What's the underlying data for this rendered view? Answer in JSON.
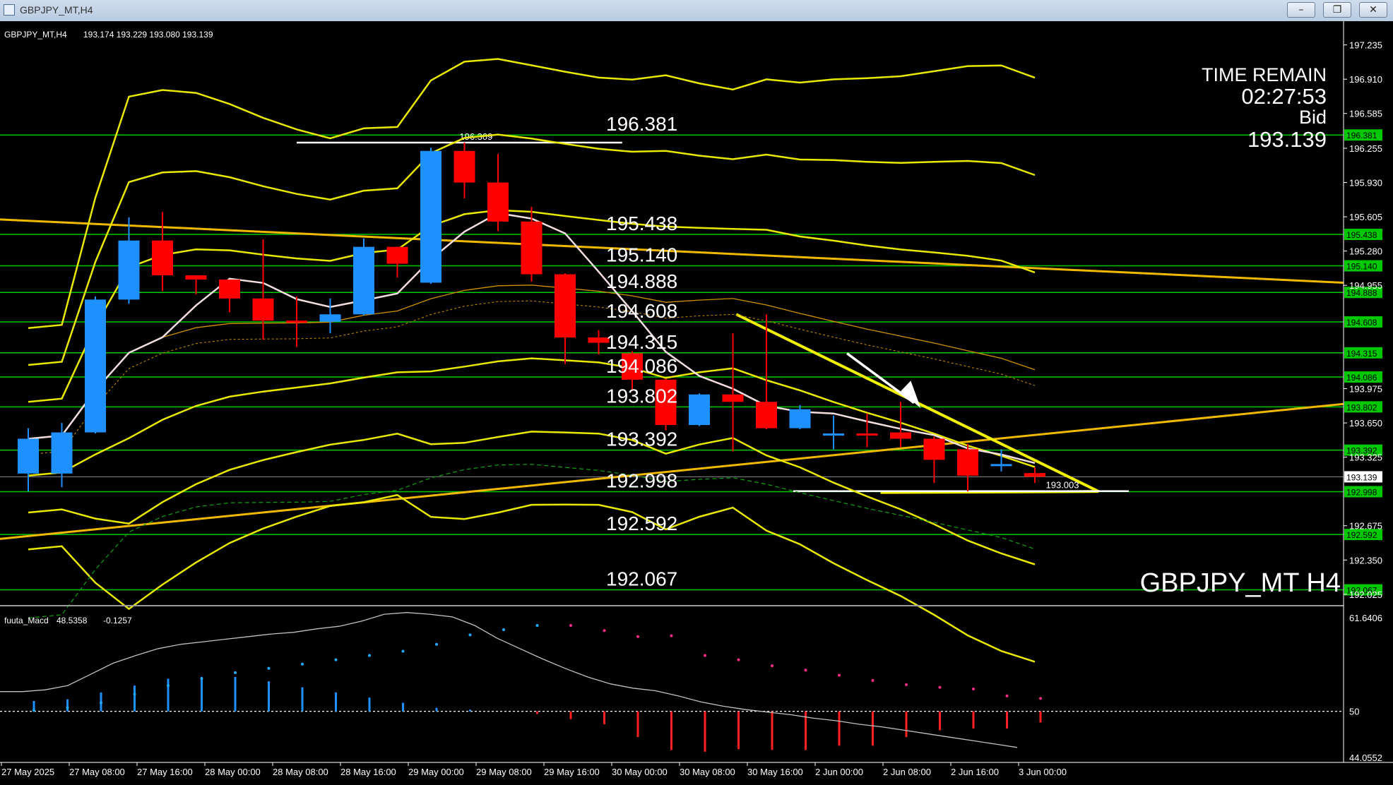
{
  "window": {
    "title": "GBPJPY_MT,H4",
    "minimize_glyph": "–",
    "restore_glyph": "❐",
    "close_glyph": "✕"
  },
  "chart_header": {
    "symbol_text": "GBPJPY_MT,H4",
    "ohlc_text": "193.174 193.229 193.080 193.139"
  },
  "time_remain": {
    "label": "TIME REMAIN",
    "value": "02:27:53",
    "bid_label": "Bid",
    "bid_value": "193.139"
  },
  "watermark": "GBPJPY_MT H4",
  "colors": {
    "background": "#000000",
    "bull_candle": "#1e90ff",
    "bear_candle": "#ff0000",
    "level_line": "#00c800",
    "level_tag": "#00c800",
    "bollinger": "#e8e800",
    "trendline": "#f0b800",
    "ma": "#f2dede",
    "macd_line": "#c0c0c0",
    "macd_up": "#1e90ff",
    "macd_down": "#ff2020"
  },
  "chart_data": {
    "type": "candlestick",
    "price_axis": {
      "ticks": [
        197.235,
        196.91,
        196.585,
        196.255,
        195.93,
        195.605,
        195.28,
        194.955,
        193.975,
        193.65,
        193.325,
        192.675,
        192.35,
        192.025
      ],
      "labels": [
        "197.235",
        "196.910",
        "196.585",
        "196.255",
        "195.930",
        "195.605",
        "195.280",
        "194.955",
        "193.975",
        "193.650",
        "193.325",
        "192.675",
        "192.350",
        "192.025"
      ],
      "range": [
        191.95,
        197.38
      ]
    },
    "levels": [
      {
        "value": 196.381,
        "label": "196.381"
      },
      {
        "value": 195.438,
        "label": "195.438"
      },
      {
        "value": 195.14,
        "label": "195.140"
      },
      {
        "value": 194.888,
        "label": "194.888"
      },
      {
        "value": 194.608,
        "label": "194.608"
      },
      {
        "value": 194.315,
        "label": "194.315"
      },
      {
        "value": 194.086,
        "label": "194.086"
      },
      {
        "value": 193.802,
        "label": "193.802"
      },
      {
        "value": 193.392,
        "label": "193.392"
      },
      {
        "value": 192.998,
        "label": "192.998"
      },
      {
        "value": 192.592,
        "label": "192.592"
      },
      {
        "value": 192.067,
        "label": "192.067"
      }
    ],
    "bid_tag": {
      "value": 193.139,
      "label": "193.139"
    },
    "annotations": [
      {
        "value": 196.309,
        "label": "196.309",
        "from": 8,
        "to": 17.7
      },
      {
        "value": 193.003,
        "label": "193.003",
        "from": 22.8,
        "to": 32.8
      }
    ],
    "candles": [
      {
        "o": 193.17,
        "h": 193.6,
        "l": 193.0,
        "c": 193.5
      },
      {
        "o": 193.17,
        "h": 193.65,
        "l": 193.04,
        "c": 193.56
      },
      {
        "o": 193.56,
        "h": 194.85,
        "l": 193.55,
        "c": 194.82
      },
      {
        "o": 194.82,
        "h": 195.6,
        "l": 194.78,
        "c": 195.38
      },
      {
        "o": 195.38,
        "h": 195.65,
        "l": 194.9,
        "c": 195.05
      },
      {
        "o": 195.05,
        "h": 195.04,
        "l": 194.87,
        "c": 195.01
      },
      {
        "o": 195.01,
        "h": 195.0,
        "l": 194.7,
        "c": 194.83
      },
      {
        "o": 194.83,
        "h": 195.39,
        "l": 194.44,
        "c": 194.62
      },
      {
        "o": 194.62,
        "h": 194.85,
        "l": 194.37,
        "c": 194.61
      },
      {
        "o": 194.61,
        "h": 194.83,
        "l": 194.5,
        "c": 194.68
      },
      {
        "o": 194.68,
        "h": 195.4,
        "l": 194.67,
        "c": 195.32
      },
      {
        "o": 195.32,
        "h": 195.31,
        "l": 195.03,
        "c": 195.16
      },
      {
        "o": 194.98,
        "h": 196.26,
        "l": 194.97,
        "c": 196.23
      },
      {
        "o": 196.23,
        "h": 196.31,
        "l": 195.78,
        "c": 195.93
      },
      {
        "o": 195.93,
        "h": 196.2,
        "l": 195.47,
        "c": 195.56
      },
      {
        "o": 195.56,
        "h": 195.7,
        "l": 194.99,
        "c": 195.06
      },
      {
        "o": 195.06,
        "h": 195.07,
        "l": 194.21,
        "c": 194.46
      },
      {
        "o": 194.46,
        "h": 194.53,
        "l": 194.3,
        "c": 194.41
      },
      {
        "o": 194.31,
        "h": 194.33,
        "l": 193.95,
        "c": 194.06
      },
      {
        "o": 194.06,
        "h": 194.07,
        "l": 193.58,
        "c": 193.63
      },
      {
        "o": 193.63,
        "h": 193.93,
        "l": 193.62,
        "c": 193.92
      },
      {
        "o": 193.92,
        "h": 194.5,
        "l": 193.38,
        "c": 193.85
      },
      {
        "o": 193.85,
        "h": 194.68,
        "l": 193.59,
        "c": 193.6
      },
      {
        "o": 193.6,
        "h": 193.82,
        "l": 193.59,
        "c": 193.78
      },
      {
        "o": 193.55,
        "h": 193.72,
        "l": 193.4,
        "c": 193.55
      },
      {
        "o": 193.55,
        "h": 193.74,
        "l": 193.42,
        "c": 193.54
      },
      {
        "o": 193.56,
        "h": 193.85,
        "l": 193.42,
        "c": 193.5
      },
      {
        "o": 193.5,
        "h": 193.52,
        "l": 193.08,
        "c": 193.3
      },
      {
        "o": 193.4,
        "h": 193.45,
        "l": 193.0,
        "c": 193.15
      },
      {
        "o": 193.25,
        "h": 193.4,
        "l": 193.19,
        "c": 193.26
      },
      {
        "o": 193.174,
        "h": 193.229,
        "l": 193.08,
        "c": 193.139
      }
    ],
    "time_axis": [
      "27 May 2025",
      "27 May 08:00",
      "27 May 16:00",
      "28 May 00:00",
      "28 May 08:00",
      "28 May 16:00",
      "29 May 00:00",
      "29 May 08:00",
      "29 May 16:00",
      "30 May 00:00",
      "30 May 08:00",
      "30 May 16:00",
      "2 Jun 00:00",
      "2 Jun 08:00",
      "2 Jun 16:00",
      "3 Jun 00:00"
    ],
    "indicator": {
      "name": "fuuta_Macd",
      "value_text": "48.5358",
      "second_text": "-0.1257",
      "axis_labels": [
        "61.6406",
        "50",
        "44.0552"
      ],
      "range": [
        44.0552,
        61.6406
      ],
      "baseline": 50,
      "line": [
        52.3,
        52.3,
        52.5,
        53.0,
        54.3,
        55.6,
        56.5,
        57.3,
        57.8,
        58.1,
        58.4,
        58.7,
        59.0,
        59.2,
        59.6,
        59.9,
        60.5,
        61.3,
        61.5,
        61.3,
        61.0,
        60.0,
        58.5,
        57.3,
        56.1,
        55.0,
        54.0,
        53.2,
        52.7,
        52.4,
        51.8,
        51.1,
        50.6,
        50.2,
        49.9,
        49.6,
        49.2,
        48.9,
        48.5,
        48.2,
        47.8,
        47.4,
        47.0,
        46.6,
        46.2,
        45.8
      ],
      "histogram": [
        1.2,
        1.4,
        2.2,
        3.0,
        3.8,
        4.0,
        4.0,
        3.5,
        2.8,
        2.2,
        1.6,
        1.0,
        0.4,
        0.2,
        0,
        -0.3,
        -0.9,
        -1.5,
        -3.0,
        -4.5,
        -4.7,
        -4.4,
        -4.5,
        -4.5,
        -4.0,
        -4.0,
        -3.0,
        -2.2,
        -2.0,
        -2.0,
        -1.3
      ],
      "signal_dots": [
        50.1,
        50.4,
        51.0,
        52.0,
        53.0,
        53.8,
        54.5,
        55.0,
        55.5,
        56.0,
        56.5,
        57.0,
        57.8,
        58.9,
        59.5,
        60.0,
        60.0,
        59.4,
        58.7,
        58.8,
        56.5,
        56.0,
        55.3,
        54.8,
        54.2,
        53.6,
        53.1,
        52.8,
        52.6,
        51.8,
        51.5
      ]
    }
  }
}
